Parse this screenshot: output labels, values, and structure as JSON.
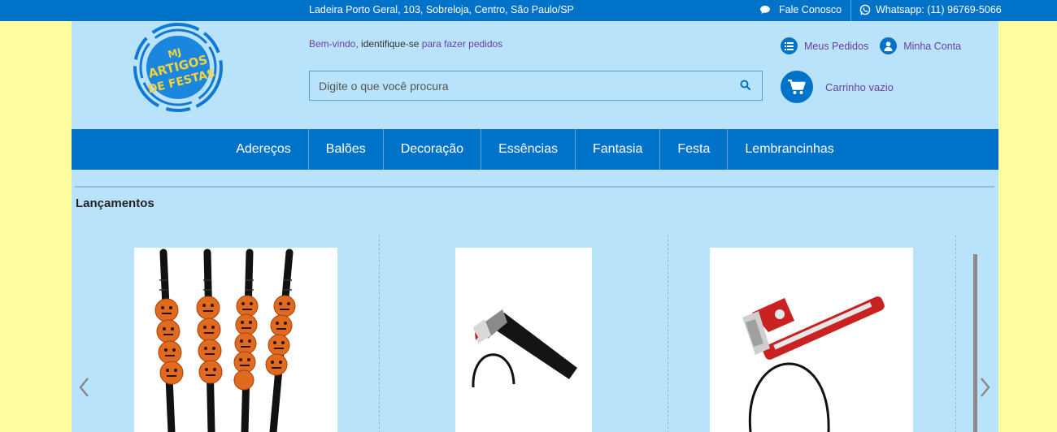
{
  "topbar": {
    "address": "Ladeira Porto Geral, 103, Sobreloja, Centro, São Paulo/SP",
    "contact_label": "Fale Conosco",
    "whatsapp_label": "Whatsapp: (11) 96769-5066",
    "background": "#0073c8"
  },
  "logo": {
    "lines": [
      "MJ",
      "ARTIGOS",
      "DE FESTAS"
    ],
    "text_color": "#f3d23b",
    "ring_color": "#1179d4"
  },
  "header": {
    "welcome_text": "Bem-vindo,",
    "identify_text": "identifique-se",
    "order_text": "para fazer pedidos",
    "search_placeholder": "Digite o que você procura",
    "my_orders_label": "Meus Pedidos",
    "my_account_label": "Minha Conta",
    "cart_label": "Carrinho vazio"
  },
  "nav": {
    "items": [
      {
        "label": "Adereços"
      },
      {
        "label": "Balões"
      },
      {
        "label": "Decoração"
      },
      {
        "label": "Essências"
      },
      {
        "label": "Fantasia"
      },
      {
        "label": "Festa"
      },
      {
        "label": "Lembrancinhas"
      }
    ]
  },
  "section": {
    "title": "Lançamentos"
  },
  "carousel": {
    "products": [
      {
        "image": "pumpkin-straws-image"
      },
      {
        "image": "axe-headband-image"
      },
      {
        "image": "wrench-headband-image"
      }
    ],
    "prev_icon": "chevron-left-icon",
    "next_icon": "chevron-right-icon"
  },
  "colors": {
    "brand_blue": "#0073c8",
    "page_background": "#b8e3fb",
    "outer_background": "#fdfda0",
    "link_purple": "#6b3fa0"
  }
}
